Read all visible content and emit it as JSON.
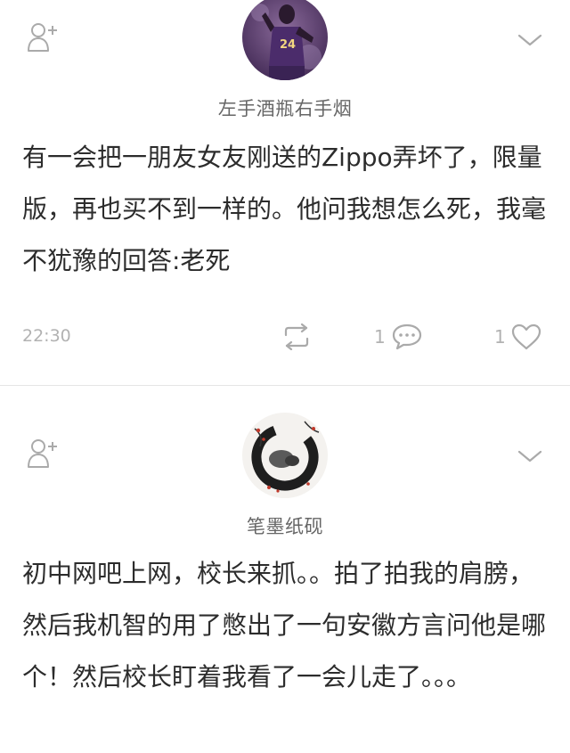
{
  "posts": [
    {
      "username": "左手酒瓶右手烟",
      "avatar_desc": "basketball-player-avatar",
      "content": "有一会把一朋友女友刚送的Zippo弄坏了，限量版，再也买不到一样的。他问我想怎么死，我毫不犹豫的回答:老死",
      "time": "22:30",
      "comment_count": "1",
      "like_count": "1"
    },
    {
      "username": "笔墨纸砚",
      "avatar_desc": "ink-painting-avatar",
      "content": "初中网吧上网，校长来抓。。拍了拍我的肩膀，然后我机智的用了憋出了一句安徽方言问他是哪个！然后校长盯着我看了一会儿走了。。。"
    }
  ],
  "icons": {
    "follow": "add-user-icon",
    "more": "chevron-down-icon",
    "repost": "repost-icon",
    "comment": "comment-icon",
    "like": "heart-icon"
  },
  "colors": {
    "icon_gray": "#aaaaaa",
    "text_main": "#2c2c2c",
    "text_meta": "#b2b2b2",
    "divider": "#e5e5e5"
  }
}
